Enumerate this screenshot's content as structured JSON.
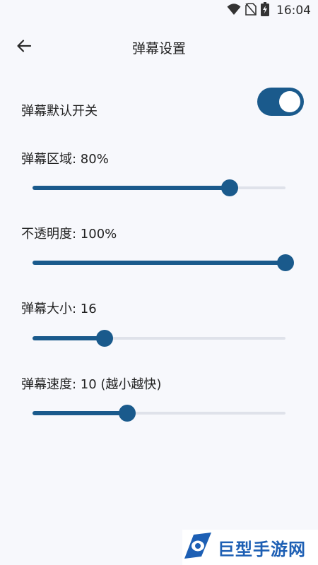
{
  "status_bar": {
    "time": "16:04",
    "icons": [
      "wifi-icon",
      "no-sim-icon",
      "battery-charging-icon"
    ]
  },
  "header": {
    "title": "弹幕设置",
    "back_icon": "arrow-left-icon"
  },
  "settings": {
    "toggle": {
      "label": "弹幕默认开关",
      "on": true
    },
    "sliders": [
      {
        "label": "弹幕区域: 80%",
        "fraction": 0.78
      },
      {
        "label": "不透明度: 100%",
        "fraction": 1.0
      },
      {
        "label": "弹幕大小: 16",
        "fraction": 0.285
      },
      {
        "label": "弹幕速度: 10 (越小越快)",
        "fraction": 0.375
      }
    ]
  },
  "watermark": {
    "text": "巨型手游网",
    "logo_icon": "eye-logo-icon"
  },
  "colors": {
    "accent": "#1a5a8c",
    "track": "#dfe2ea",
    "background": "#f7f8fc",
    "watermark": "#1d5fb4"
  }
}
